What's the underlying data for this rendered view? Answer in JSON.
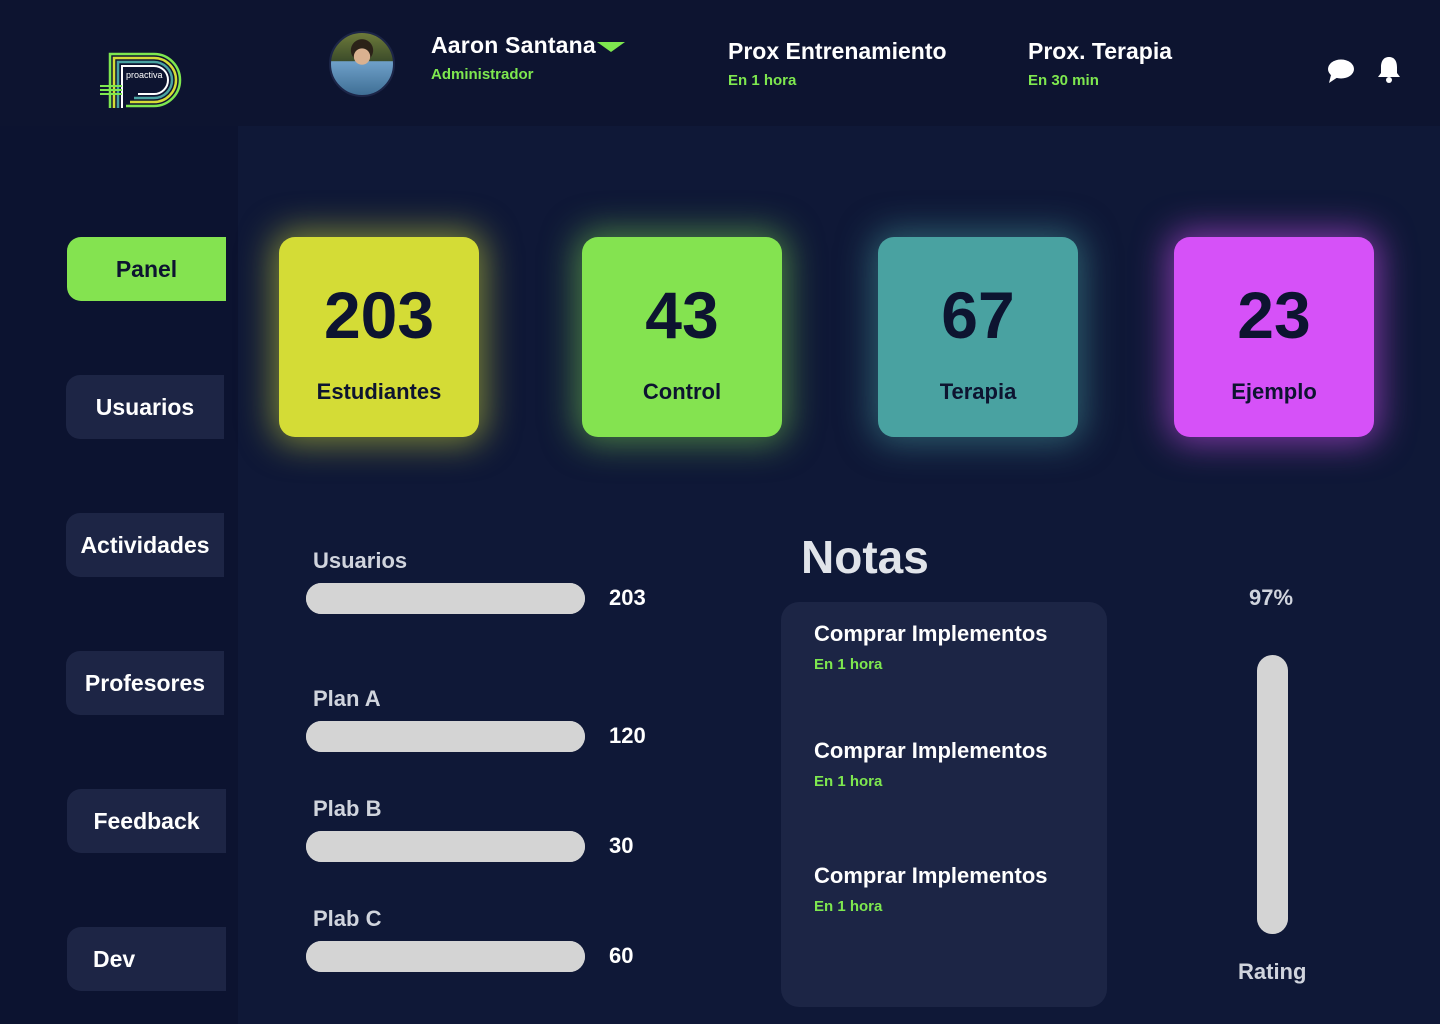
{
  "brand": {
    "logo_text": "proactiva"
  },
  "header": {
    "user": {
      "name": "Aaron Santana",
      "role": "Administrador"
    },
    "next_training": {
      "title": "Prox Entrenamiento",
      "time": "En 1 hora"
    },
    "next_therapy": {
      "title": "Prox. Terapia",
      "time": "En 30 min"
    },
    "icons": [
      "chat-bubble-icon",
      "bell-icon"
    ]
  },
  "sidebar": {
    "items": [
      {
        "label": "Panel",
        "active": true
      },
      {
        "label": "Usuarios",
        "active": false
      },
      {
        "label": "Actividades",
        "active": false
      },
      {
        "label": "Profesores",
        "active": false
      },
      {
        "label": "Feedback",
        "active": false
      },
      {
        "label": "Dev",
        "active": false
      }
    ]
  },
  "stats": [
    {
      "value": "203",
      "label": "Estudiantes",
      "color": "#d4dc36"
    },
    {
      "value": "43",
      "label": "Control",
      "color": "#84e350"
    },
    {
      "value": "67",
      "label": "Terapia",
      "color": "#49a2a1"
    },
    {
      "value": "23",
      "label": "Ejemplo",
      "color": "#d651f8"
    }
  ],
  "bars": [
    {
      "label": "Usuarios",
      "value": "203",
      "fill": 1.0
    },
    {
      "label": "Plan A",
      "value": "120",
      "fill": 1.0
    },
    {
      "label": "Plab B",
      "value": "30",
      "fill": 1.0
    },
    {
      "label": "Plab C",
      "value": "60",
      "fill": 1.0
    }
  ],
  "notes": {
    "title": "Notas",
    "items": [
      {
        "title": "Comprar Implementos",
        "time": "En 1 hora"
      },
      {
        "title": "Comprar Implementos",
        "time": "En 1 hora"
      },
      {
        "title": "Comprar Implementos",
        "time": "En 1 hora"
      }
    ]
  },
  "rating": {
    "percent_label": "97%",
    "level": 0.97,
    "label": "Rating"
  },
  "colors": {
    "background": "#0d1430",
    "panel": "#1c2545",
    "accent": "#7ee84f",
    "bar": "#d4d4d4"
  }
}
